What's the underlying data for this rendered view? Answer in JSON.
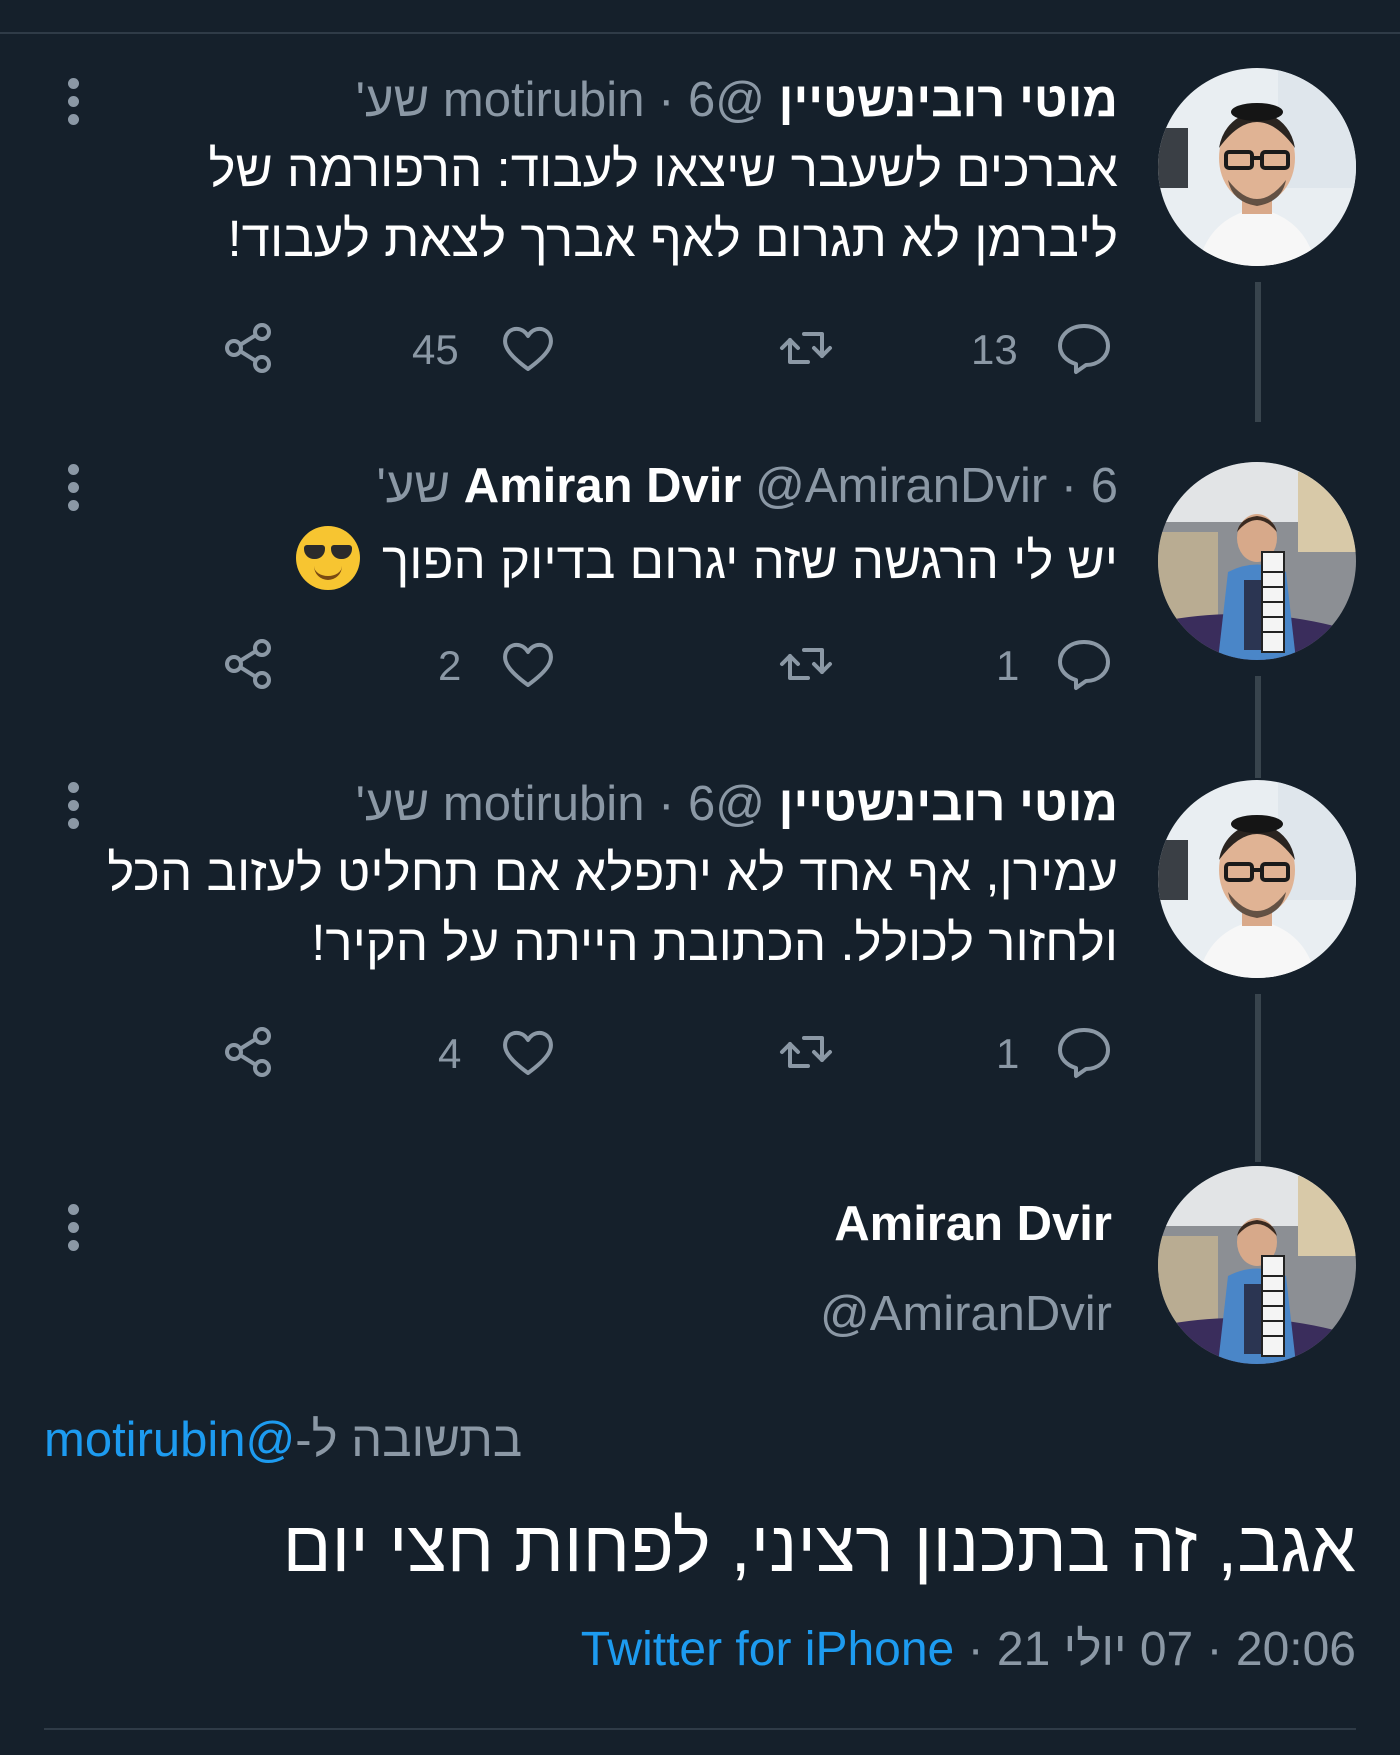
{
  "thread": [
    {
      "display_name": "מוטי רובינשטיין",
      "handle": "@motirubin",
      "time": "6 שע'",
      "text_lines": [
        "אברכים לשעבר שיצאו לעבוד: הרפורמה של",
        "ליברמן לא תגרום לאף אברך לצאת לעבוד!"
      ],
      "emoji": "",
      "replies": "13",
      "retweets": "",
      "likes": "45"
    },
    {
      "display_name": "Amiran Dvir",
      "handle": "@AmiranDvir",
      "time": "6 שע'",
      "text_lines": [
        "יש לי הרגשה שזה יגרום בדיוק הפוך"
      ],
      "emoji": "smiling-face-with-sunglasses",
      "replies": "1",
      "retweets": "",
      "likes": "2"
    },
    {
      "display_name": "מוטי רובינשטיין",
      "handle": "@motirubin",
      "time": "6 שע'",
      "text_lines": [
        "עמירן, אף אחד לא יתפלא אם תחליט לעזוב הכל",
        "ולחזור לכולל. הכתובת הייתה על הקיר!"
      ],
      "emoji": "",
      "replies": "1",
      "retweets": "",
      "likes": "4"
    }
  ],
  "separator": "·",
  "main_tweet": {
    "display_name": "Amiran Dvir",
    "handle": "@AmiranDvir",
    "reply_prefix": "בתשובה ל-",
    "reply_mention": "@motirubin",
    "text": "אגב, זה בתכנון רציני, לפחות חצי יום",
    "time": "20:06",
    "date": "07 יולי 21",
    "source": "Twitter for iPhone"
  },
  "colors": {
    "background": "#15202b",
    "secondary_text": "#8b98a5",
    "accent": "#1d9bf0",
    "divider": "#2f3b47"
  },
  "icons": [
    "share-icon",
    "heart-icon",
    "retweet-icon",
    "reply-icon",
    "more-options-icon"
  ]
}
